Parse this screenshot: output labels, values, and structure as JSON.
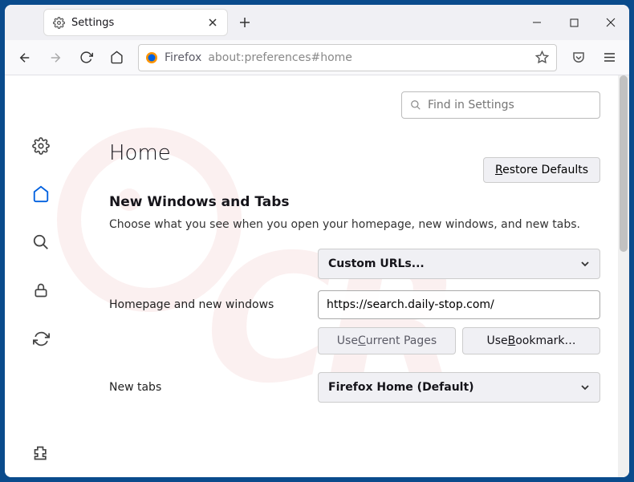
{
  "window": {
    "tab_title": "Settings",
    "newtab_tooltip": "New Tab"
  },
  "toolbar": {
    "firefox_label": "Firefox",
    "url": "about:preferences#home"
  },
  "search": {
    "placeholder": "Find in Settings"
  },
  "page": {
    "heading": "Home",
    "restore_label": "Restore Defaults",
    "section_title": "New Windows and Tabs",
    "section_desc": "Choose what you see when you open your homepage, new windows, and new tabs."
  },
  "form": {
    "homepage_select": "Custom URLs...",
    "homepage_label": "Homepage and new windows",
    "homepage_url": "https://search.daily-stop.com/",
    "use_current": "Use Current Pages",
    "use_bookmark": "Use Bookmark…",
    "newtabs_label": "New tabs",
    "newtabs_select": "Firefox Home (Default)"
  }
}
